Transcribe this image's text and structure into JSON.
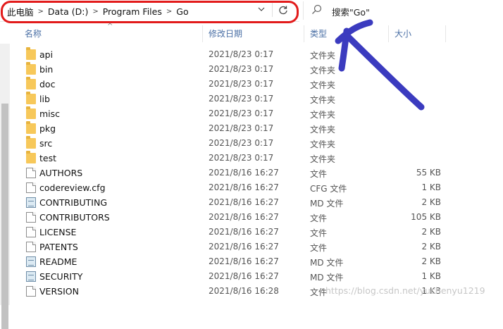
{
  "address": {
    "crumbs": [
      "此电脑",
      "Data (D:)",
      "Program Files",
      "Go"
    ],
    "separator": ">"
  },
  "search": {
    "placeholder": "搜索\"Go\""
  },
  "columns": {
    "name": "名称",
    "date": "修改日期",
    "type": "类型",
    "size": "大小"
  },
  "files": [
    {
      "name": "api",
      "date": "2021/8/23 0:17",
      "type": "文件夹",
      "size": "",
      "icon": "folder-icon"
    },
    {
      "name": "bin",
      "date": "2021/8/23 0:17",
      "type": "文件夹",
      "size": "",
      "icon": "folder-icon"
    },
    {
      "name": "doc",
      "date": "2021/8/23 0:17",
      "type": "文件夹",
      "size": "",
      "icon": "folder-icon"
    },
    {
      "name": "lib",
      "date": "2021/8/23 0:17",
      "type": "文件夹",
      "size": "",
      "icon": "folder-icon"
    },
    {
      "name": "misc",
      "date": "2021/8/23 0:17",
      "type": "文件夹",
      "size": "",
      "icon": "folder-icon"
    },
    {
      "name": "pkg",
      "date": "2021/8/23 0:17",
      "type": "文件夹",
      "size": "",
      "icon": "folder-icon"
    },
    {
      "name": "src",
      "date": "2021/8/23 0:17",
      "type": "文件夹",
      "size": "",
      "icon": "folder-icon"
    },
    {
      "name": "test",
      "date": "2021/8/23 0:17",
      "type": "文件夹",
      "size": "",
      "icon": "folder-icon"
    },
    {
      "name": "AUTHORS",
      "date": "2021/8/16 16:27",
      "type": "文件",
      "size": "55 KB",
      "icon": "file-icon"
    },
    {
      "name": "codereview.cfg",
      "date": "2021/8/16 16:27",
      "type": "CFG 文件",
      "size": "1 KB",
      "icon": "file-icon"
    },
    {
      "name": "CONTRIBUTING",
      "date": "2021/8/16 16:27",
      "type": "MD 文件",
      "size": "2 KB",
      "icon": "markdown-file-icon"
    },
    {
      "name": "CONTRIBUTORS",
      "date": "2021/8/16 16:27",
      "type": "文件",
      "size": "105 KB",
      "icon": "file-icon"
    },
    {
      "name": "LICENSE",
      "date": "2021/8/16 16:27",
      "type": "文件",
      "size": "2 KB",
      "icon": "file-icon"
    },
    {
      "name": "PATENTS",
      "date": "2021/8/16 16:27",
      "type": "文件",
      "size": "2 KB",
      "icon": "file-icon"
    },
    {
      "name": "README",
      "date": "2021/8/16 16:27",
      "type": "MD 文件",
      "size": "2 KB",
      "icon": "markdown-file-icon"
    },
    {
      "name": "SECURITY",
      "date": "2021/8/16 16:27",
      "type": "MD 文件",
      "size": "1 KB",
      "icon": "markdown-file-icon"
    },
    {
      "name": "VERSION",
      "date": "2021/8/16 16:28",
      "type": "文件",
      "size": "1 KB",
      "icon": "file-icon"
    }
  ],
  "watermark": "https://blog.csdn.net/yuchenyu1219",
  "colors": {
    "highlight_box": "#e21b1b",
    "annotation_arrow": "#3b3bbf",
    "folder": "#f7c85a",
    "header_text": "#4a6fa5"
  }
}
